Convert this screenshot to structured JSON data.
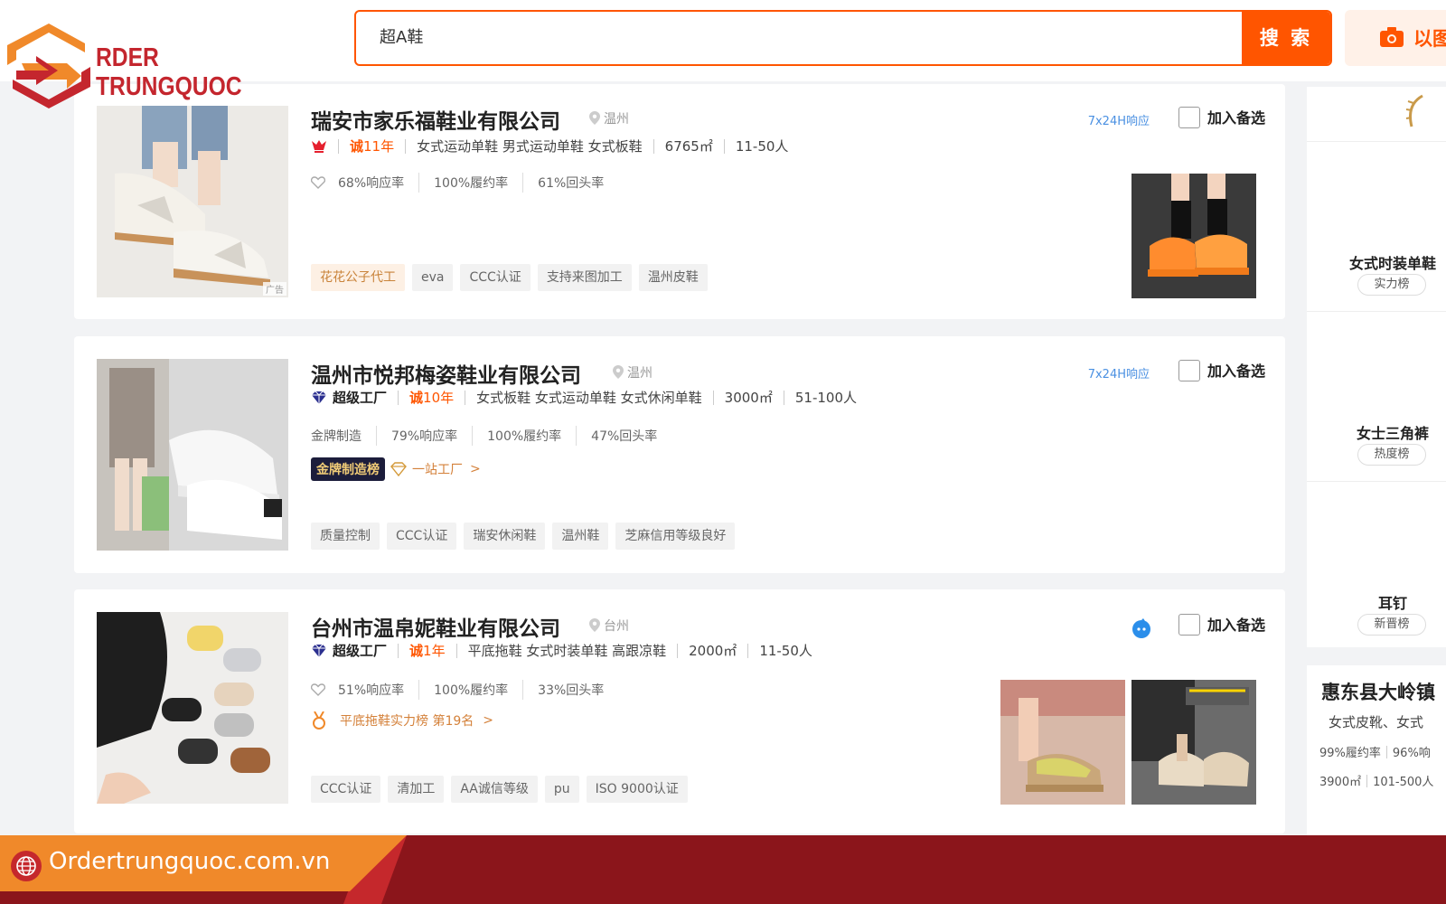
{
  "logo": {
    "line1": "RDER",
    "line2": "TRUNGQUOC"
  },
  "search": {
    "value": "超A鞋",
    "button_label": "搜 索",
    "image_search_label": "以图"
  },
  "companies": [
    {
      "name": "瑞安市家乐福鞋业有限公司",
      "location": "温州",
      "response_tag": "7x24H响应",
      "select_label": "加入备选",
      "cheng_glyph": "诚",
      "years": "11年",
      "products": "女式运动单鞋 男式运动单鞋 女式板鞋",
      "area": "6765㎡",
      "staff": "11-50人",
      "response_rate": "68%响应率",
      "fulfil_rate": "100%履约率",
      "repeat_rate": "61%回头率",
      "tags": [
        "花花公子代工",
        "eva",
        "CCC认证",
        "支持来图加工",
        "温州皮鞋"
      ],
      "ad_label": "广告"
    },
    {
      "name": "温州市悦邦梅姿鞋业有限公司",
      "location": "温州",
      "response_tag": "7x24H响应",
      "select_label": "加入备选",
      "super_factory": "超级工厂",
      "cheng_glyph": "诚",
      "years": "10年",
      "products": "女式板鞋 女式运动单鞋 女式休闲单鞋",
      "area": "3000㎡",
      "staff": "51-100人",
      "gold_label": "金牌制造",
      "response_rate": "79%响应率",
      "fulfil_rate": "100%履约率",
      "repeat_rate": "47%回头率",
      "gold_badge": "金牌制造榜",
      "one_stop": "一站工厂",
      "one_stop_arrow": ">",
      "tags": [
        "质量控制",
        "CCC认证",
        "瑞安休闲鞋",
        "温州鞋",
        "芝麻信用等级良好"
      ]
    },
    {
      "name": "台州市温帛妮鞋业有限公司",
      "location": "台州",
      "select_label": "加入备选",
      "super_factory": "超级工厂",
      "cheng_glyph": "诚",
      "years": "1年",
      "products": "平底拖鞋 女式时装单鞋 高跟凉鞋",
      "area": "2000㎡",
      "staff": "11-50人",
      "response_rate": "51%响应率",
      "fulfil_rate": "100%履约率",
      "repeat_rate": "33%回头率",
      "rank_text": "平底拖鞋实力榜 第19名",
      "rank_arrow": ">",
      "tags": [
        "CCC认证",
        "清加工",
        "AA诚信等级",
        "pu",
        "ISO 9000认证"
      ]
    }
  ],
  "sidebar": {
    "rankings": [
      {
        "name": "女式时装单鞋",
        "tag": "实力榜"
      },
      {
        "name": "女士三角裤",
        "tag": "热度榜"
      },
      {
        "name": "耳钉",
        "tag": "新晋榜"
      }
    ],
    "company_card": {
      "name": "惠东县大岭镇",
      "products": "女式皮靴、女式",
      "stats": "99%履约率",
      "stats2": "96%响",
      "area": "3900㎡",
      "staff": "101-500人"
    }
  },
  "footer": {
    "site": "Ordertrungquoc.com.vn"
  },
  "colors": {
    "accent": "#ff5500",
    "brand_red": "#c4262e",
    "footer_dark": "#8b151b",
    "footer_orange": "#f0892a",
    "link_blue": "#4a90e2"
  }
}
